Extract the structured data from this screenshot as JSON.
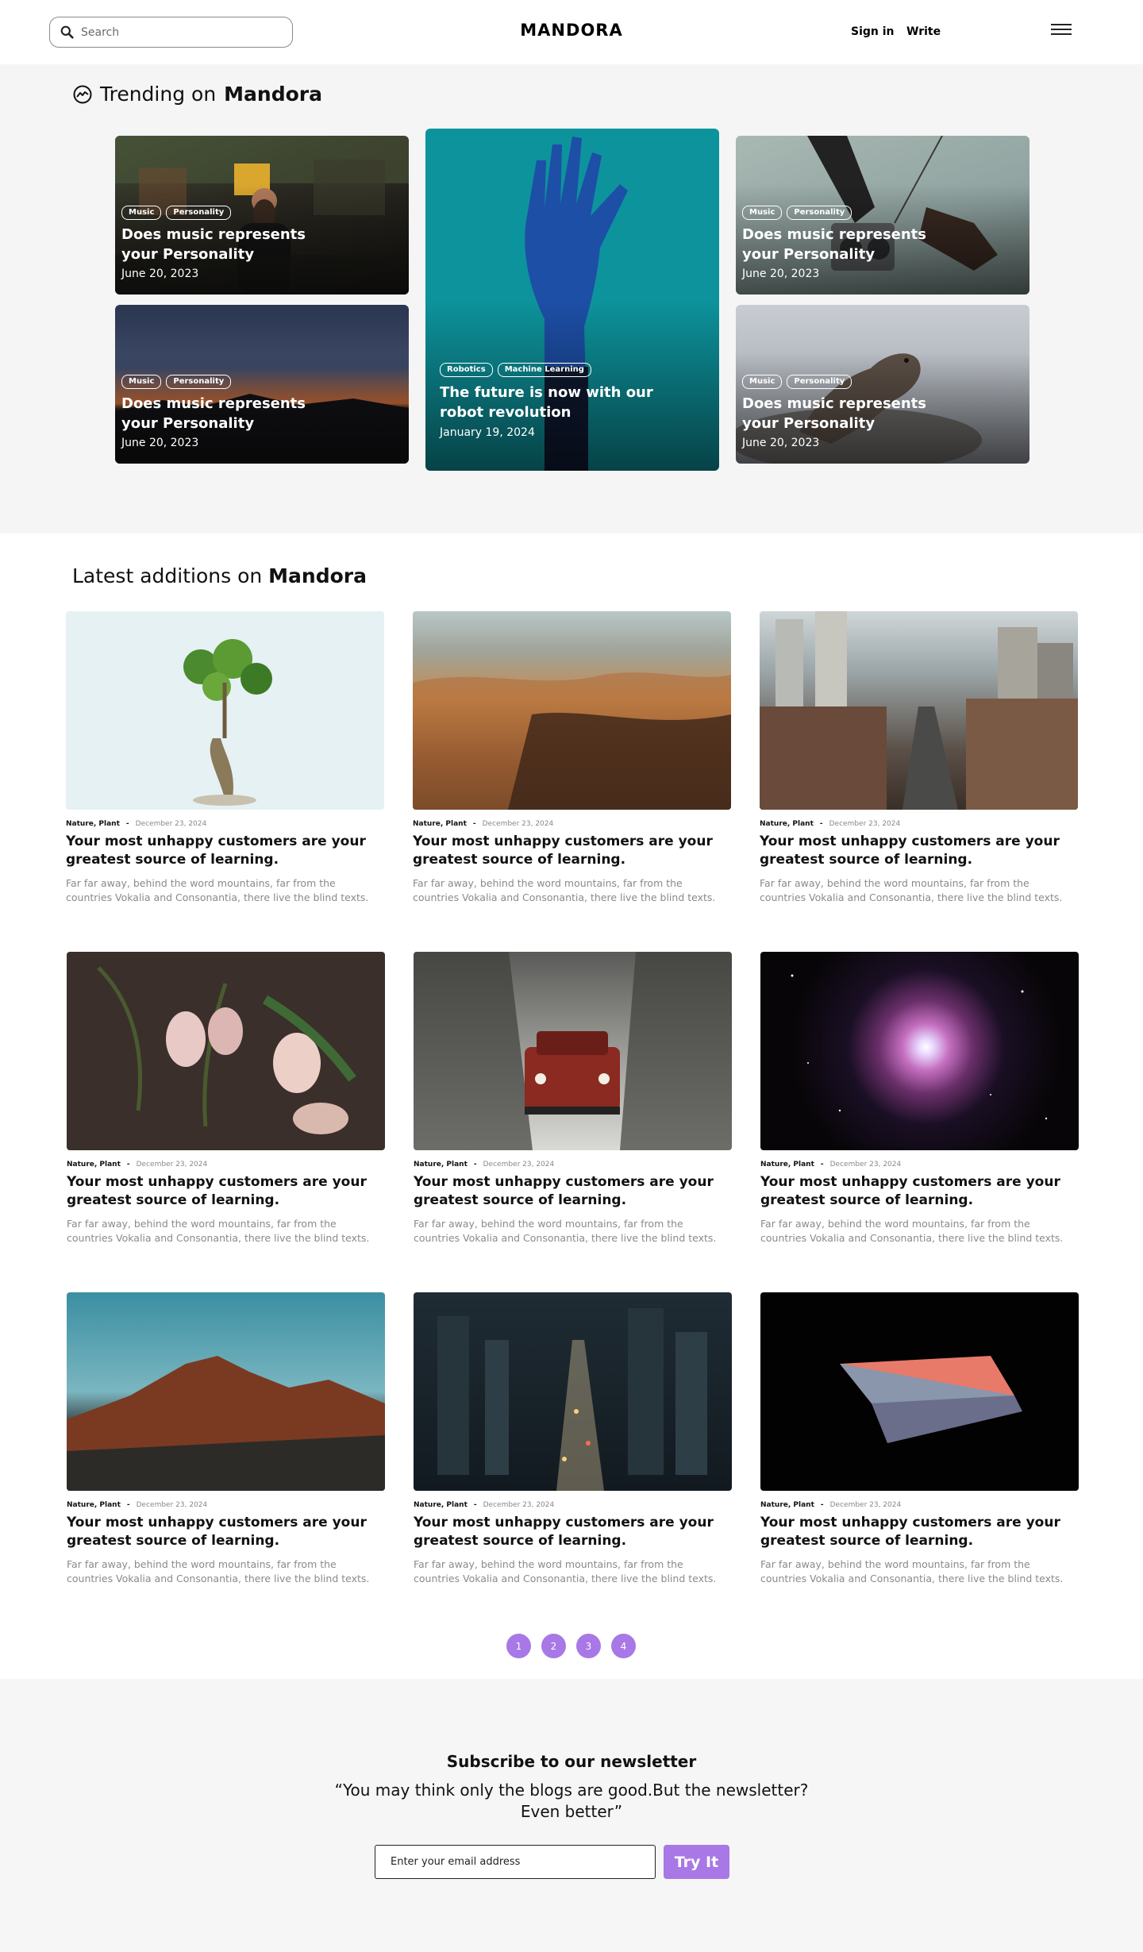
{
  "header": {
    "search_placeholder": "Search",
    "logo": "MANDORA",
    "signin": "Sign in",
    "write": "Write"
  },
  "trending": {
    "title_prefix": "Trending on",
    "title_brand": "Mandora",
    "cards": [
      {
        "tags": [
          "Music",
          "Personality"
        ],
        "title": "Does music represents your Personality",
        "date": "June 20, 2023"
      },
      {
        "tags": [
          "Music",
          "Personality"
        ],
        "title": "Does music represents your Personality",
        "date": "June 20, 2023"
      },
      {
        "tags": [
          "Robotics",
          "Machine Learning"
        ],
        "title": "The future is now with our robot revolution",
        "date": "January 19, 2024"
      },
      {
        "tags": [
          "Music",
          "Personality"
        ],
        "title": "Does music represents your Personality",
        "date": "June 20, 2023"
      },
      {
        "tags": [
          "Music",
          "Personality"
        ],
        "title": "Does music represents your Personality",
        "date": "June 20, 2023"
      }
    ]
  },
  "latest": {
    "title_prefix": "Latest additions on",
    "title_brand": "Mandora",
    "posts": [
      {
        "category": "Nature, Plant",
        "date": "December 23, 2024",
        "title": "Your most unhappy customers are your greatest source of learning.",
        "desc": "Far far away, behind the word mountains, far from the countries Vokalia and Consonantia, there live the blind texts."
      },
      {
        "category": "Nature, Plant",
        "date": "December 23, 2024",
        "title": "Your most unhappy customers are your greatest source of learning.",
        "desc": "Far far away, behind the word mountains, far from the countries Vokalia and Consonantia, there live the blind texts."
      },
      {
        "category": "Nature, Plant",
        "date": "December 23, 2024",
        "title": "Your most unhappy customers are your greatest source of learning.",
        "desc": "Far far away, behind the word mountains, far from the countries Vokalia and Consonantia, there live the blind texts."
      },
      {
        "category": "Nature, Plant",
        "date": "December 23, 2024",
        "title": "Your most unhappy customers are your greatest source of learning.",
        "desc": "Far far away, behind the word mountains, far from the countries Vokalia and Consonantia, there live the blind texts."
      },
      {
        "category": "Nature, Plant",
        "date": "December 23, 2024",
        "title": "Your most unhappy customers are your greatest source of learning.",
        "desc": "Far far away, behind the word mountains, far from the countries Vokalia and Consonantia, there live the blind texts."
      },
      {
        "category": "Nature, Plant",
        "date": "December 23, 2024",
        "title": "Your most unhappy customers are your greatest source of learning.",
        "desc": "Far far away, behind the word mountains, far from the countries Vokalia and Consonantia, there live the blind texts."
      },
      {
        "category": "Nature, Plant",
        "date": "December 23, 2024",
        "title": "Your most unhappy customers are your greatest source of learning.",
        "desc": "Far far away, behind the word mountains, far from the countries Vokalia and Consonantia, there live the blind texts."
      },
      {
        "category": "Nature, Plant",
        "date": "December 23, 2024",
        "title": "Your most unhappy customers are your greatest source of learning.",
        "desc": "Far far away, behind the word mountains, far from the countries Vokalia and Consonantia, there live the blind texts."
      },
      {
        "category": "Nature, Plant",
        "date": "December 23, 2024",
        "title": "Your most unhappy customers are your greatest source of learning.",
        "desc": "Far far away, behind the word mountains, far from the countries Vokalia and Consonantia, there live the blind texts."
      }
    ]
  },
  "pagination": [
    "1",
    "2",
    "3",
    "4"
  ],
  "newsletter": {
    "title": "Subscribe to our newsletter",
    "quote": "“You may think only the blogs are good.But the newsletter? Even better”",
    "email_placeholder": "Enter your email address",
    "button": "Try It"
  },
  "colors": {
    "accent": "#a878e6",
    "trending_bg": "#f5f5f5",
    "newsletter_bg": "#f6f6f6"
  },
  "icons": [
    "search-icon",
    "menu-icon",
    "trending-icon"
  ]
}
